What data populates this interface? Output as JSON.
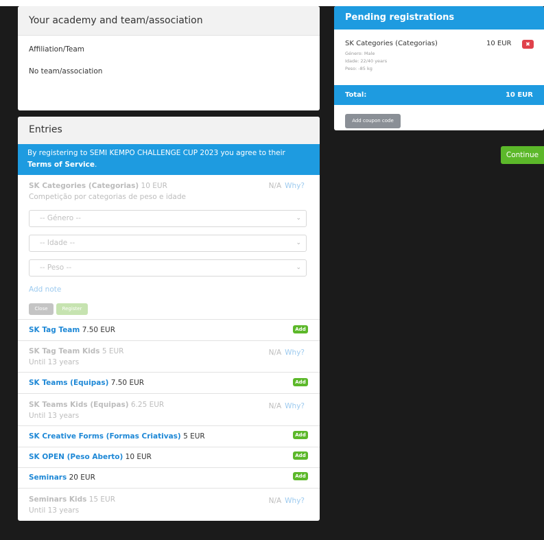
{
  "academy": {
    "header": "Your academy and team/association",
    "affiliation_label": "Affiliation/Team",
    "team_value": "No team/association"
  },
  "entries": {
    "header": "Entries",
    "tos": {
      "prefix": "By registering to SEMI KEMPO CHALLENGE CUP 2023 you agree to their ",
      "link": "Terms of Service",
      "suffix": "."
    },
    "expanded": {
      "name": "SK Categories (Categorias)",
      "price": "10 EUR",
      "description": "Competição por categorias de peso e idade",
      "na": "N/A",
      "why": "Why?",
      "selects": [
        {
          "placeholder": "-- Género --"
        },
        {
          "placeholder": "-- Idade --"
        },
        {
          "placeholder": "-- Peso --"
        }
      ],
      "add_note": "Add note",
      "close_label": "Close",
      "register_label": "Register"
    },
    "rows": [
      {
        "name": "SK Tag Team",
        "price": "7.50 EUR",
        "action": "Add"
      },
      {
        "name": "SK Tag Team Kids",
        "price": "5 EUR",
        "sub": "Until 13 years",
        "na": "N/A",
        "why": "Why?"
      },
      {
        "name": "SK Teams (Equipas)",
        "price": "7.50 EUR",
        "action": "Add"
      },
      {
        "name": "SK Teams Kids (Equipas)",
        "price": "6.25 EUR",
        "sub": "Until 13 years",
        "na": "N/A",
        "why": "Why?"
      },
      {
        "name": "SK Creative Forms (Formas Criativas)",
        "price": "5 EUR",
        "action": "Add"
      },
      {
        "name": "SK OPEN (Peso Aberto)",
        "price": "10 EUR",
        "action": "Add"
      },
      {
        "name": "Seminars",
        "price": "20 EUR",
        "action": "Add"
      },
      {
        "name": "Seminars Kids",
        "price": "15 EUR",
        "sub": "Until 13 years",
        "na": "N/A",
        "why": "Why?"
      }
    ]
  },
  "pending": {
    "header": "Pending registrations",
    "item": {
      "name": "SK Categories (Categorias)",
      "price": "10 EUR",
      "details": [
        "Género: Male",
        "Idade: 22/40 years",
        "Peso: -85 kg"
      ],
      "remove_icon": "close-icon"
    },
    "total_label": "Total:",
    "total_value": "10 EUR",
    "coupon_label": "Add coupon code"
  },
  "continue_label": "Continue",
  "colors": {
    "accent_blue": "#1e9be0",
    "add_green": "#5cb82a",
    "remove_red": "#e0414b",
    "link_blue": "#1e88d6"
  }
}
